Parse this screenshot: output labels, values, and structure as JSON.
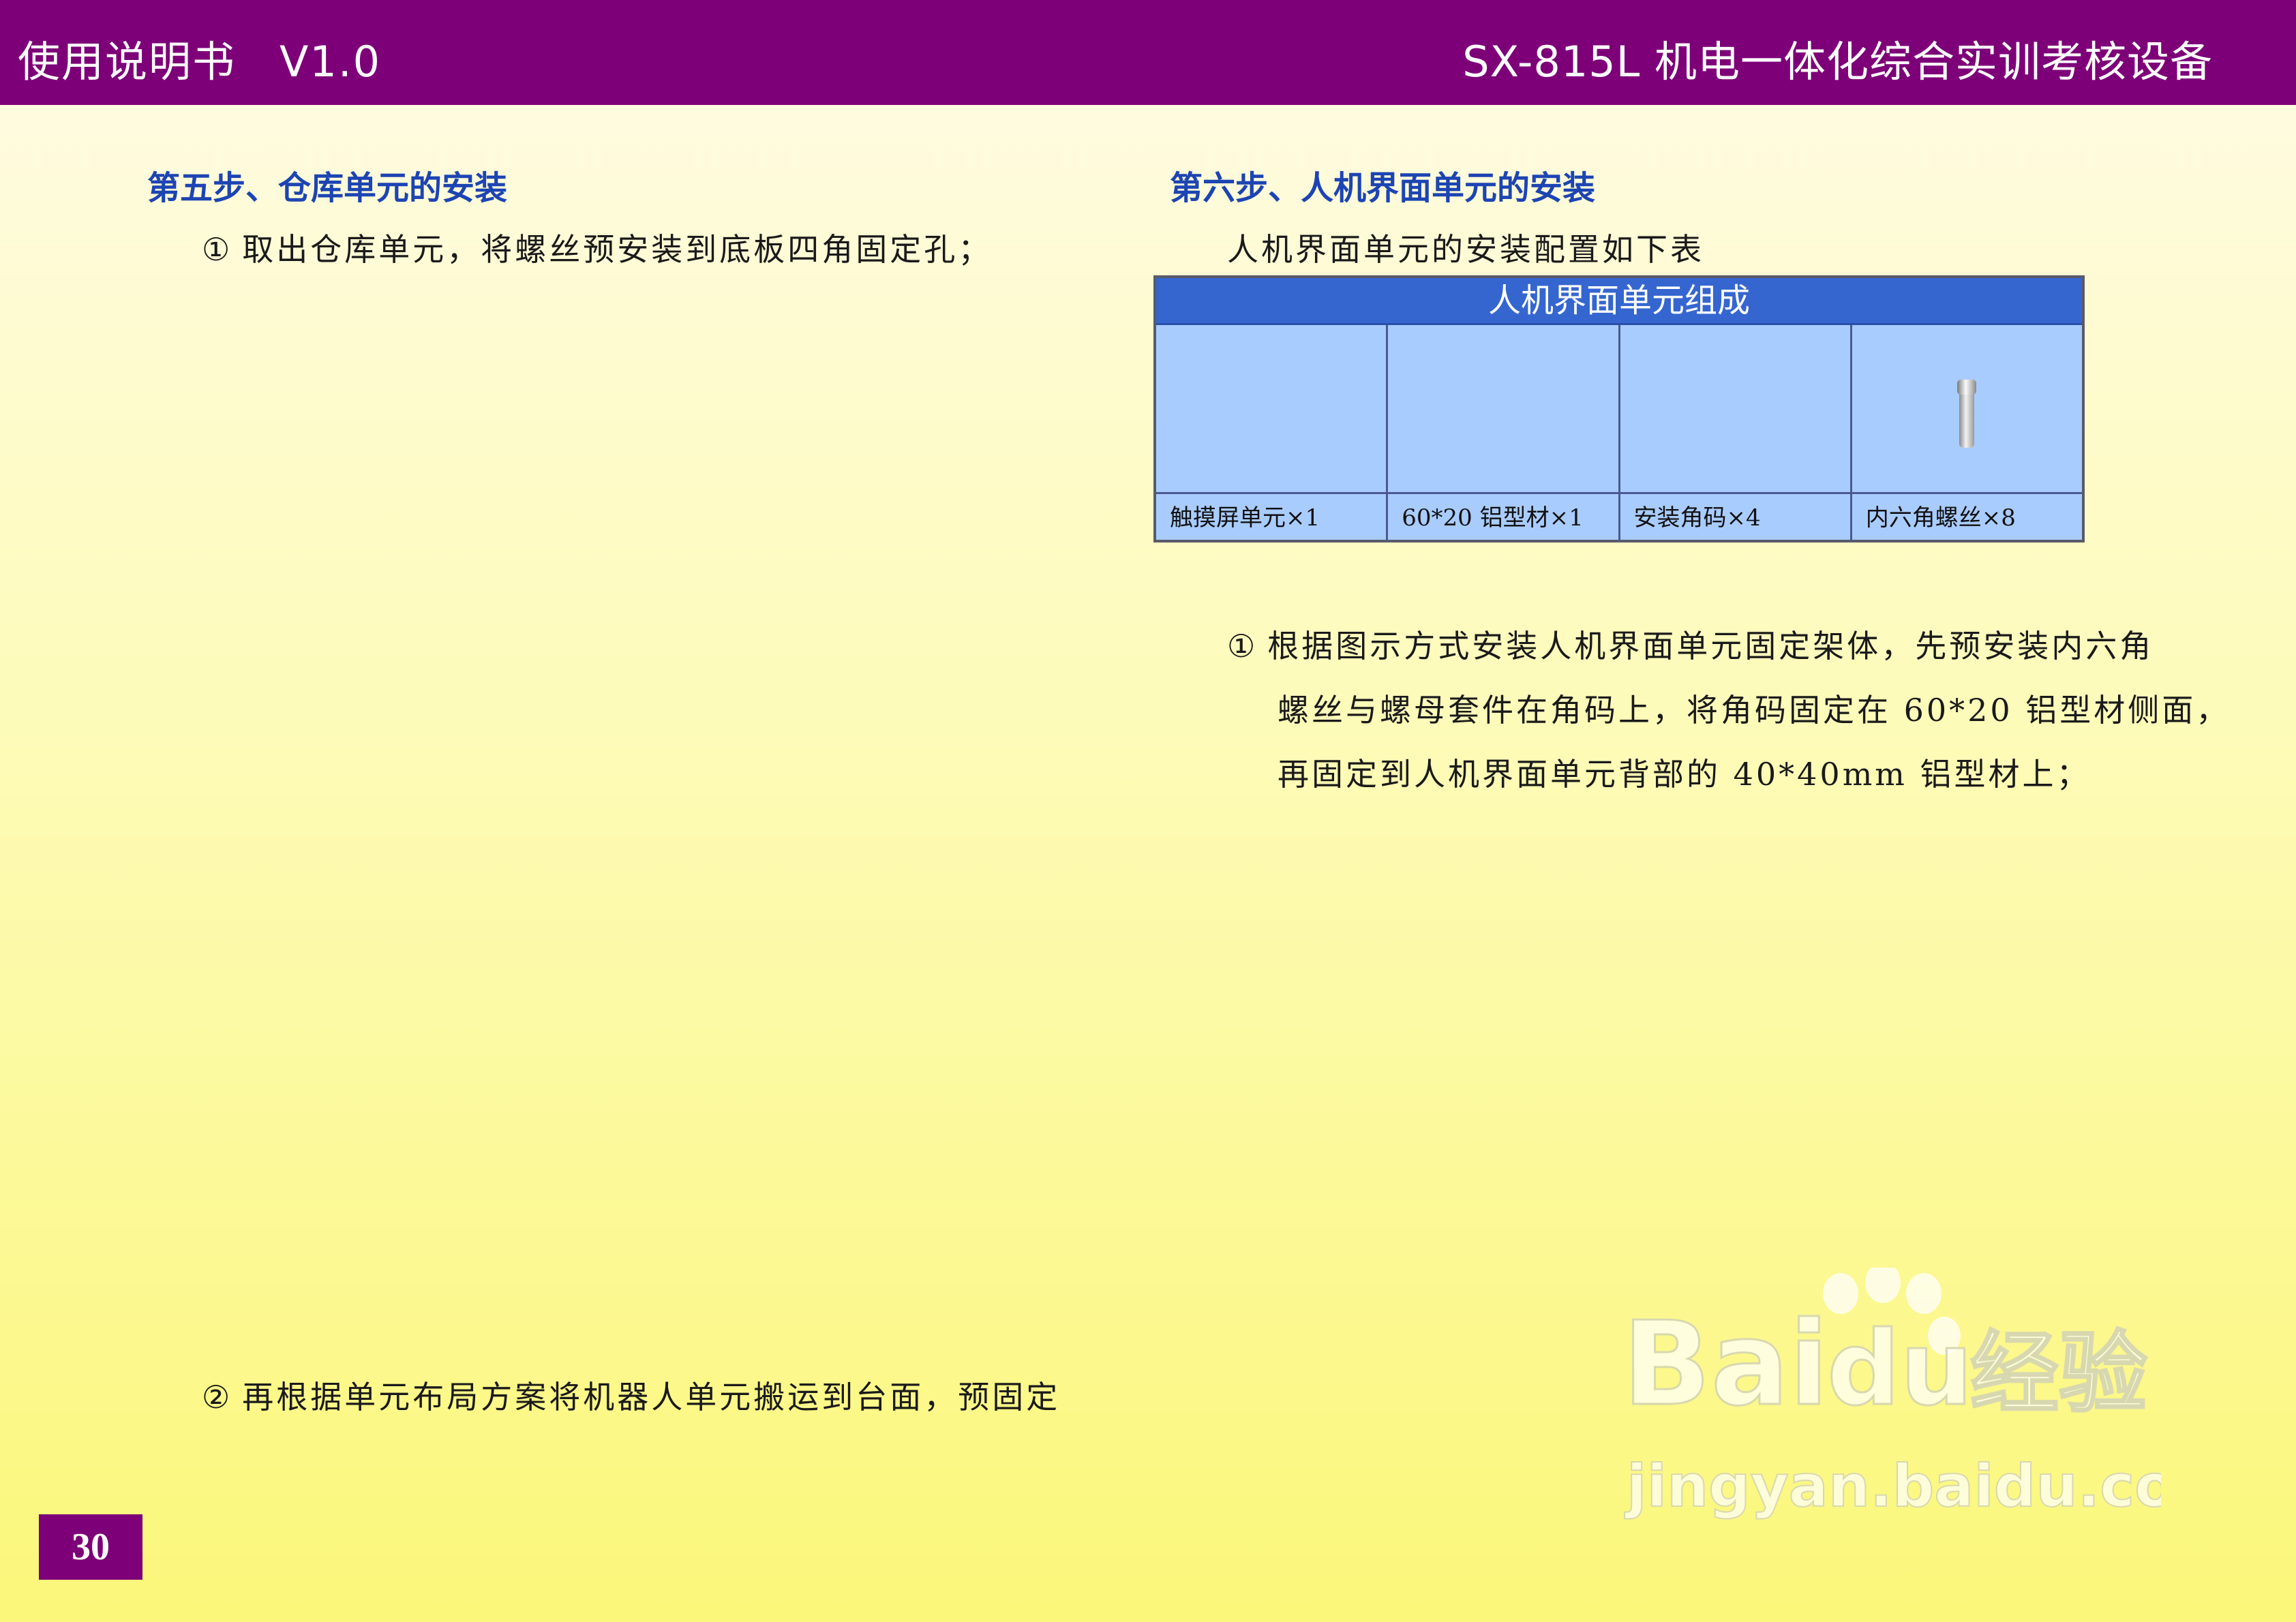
{
  "header": {
    "left": "使用说明书　V1.0",
    "right": "SX-815L 机电一体化综合实训考核设备"
  },
  "step5": {
    "heading": "第五步、仓库单元的安装",
    "item1_num": "①",
    "item1": "取出仓库单元，将螺丝预安装到底板四角固定孔；",
    "item2_num": "②",
    "item2": "再根据单元布局方案将机器人单元搬运到台面，预固定"
  },
  "step6": {
    "heading": "第六步、人机界面单元的安装",
    "intro": "人机界面单元的安装配置如下表",
    "table": {
      "title": "人机界面单元组成",
      "items": [
        {
          "label": "触摸屏单元×1",
          "icon": "touchscreen"
        },
        {
          "label": "60*20 铝型材×1",
          "icon": "aluminum-profile"
        },
        {
          "label": "安装角码×4",
          "icon": "corner-bracket"
        },
        {
          "label": "内六角螺丝×8",
          "icon": "hex-screw-icon"
        }
      ]
    },
    "item1_num": "①",
    "item1_line1": "根据图示方式安装人机界面单元固定架体，先预安装内六角",
    "item1_line2": "螺丝与螺母套件在角码上，将角码固定在 60*20 铝型材侧面，",
    "item1_line3": "再固定到人机界面单元背部的 40*40mm 铝型材上；"
  },
  "page_number": "30",
  "watermark": {
    "logo_text": "Bai du 经验",
    "url": "jingyan.baidu.com"
  },
  "colors": {
    "header_bg": "#7d0078",
    "heading": "#1c44b3",
    "table_header": "#3566d0",
    "table_body": "#a9ccff"
  }
}
